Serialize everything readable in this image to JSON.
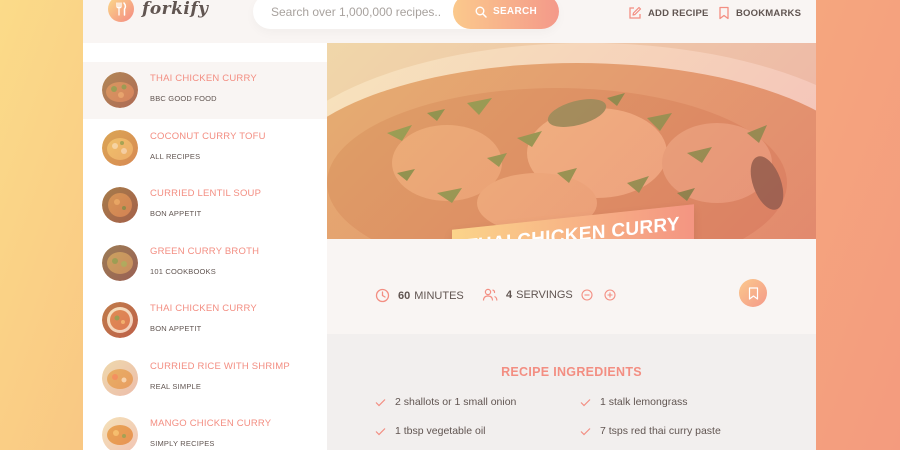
{
  "header": {
    "logo_text": "forkify",
    "search_placeholder": "Search over 1,000,000 recipes...",
    "search_button": "SEARCH",
    "add_recipe": "ADD RECIPE",
    "bookmarks": "BOOKMARKS"
  },
  "results": [
    {
      "title": "THAI CHICKEN CURRY",
      "publisher": "BBC GOOD FOOD",
      "active": true
    },
    {
      "title": "COCONUT CURRY TOFU",
      "publisher": "ALL RECIPES",
      "active": false
    },
    {
      "title": "CURRIED LENTIL SOUP",
      "publisher": "BON APPETIT",
      "active": false
    },
    {
      "title": "GREEN CURRY BROTH",
      "publisher": "101 COOKBOOKS",
      "active": false
    },
    {
      "title": "THAI CHICKEN CURRY",
      "publisher": "BON APPETIT",
      "active": false
    },
    {
      "title": "CURRIED RICE WITH SHRIMP",
      "publisher": "REAL SIMPLE",
      "active": false
    },
    {
      "title": "MANGO CHICKEN CURRY",
      "publisher": "SIMPLY RECIPES",
      "active": false
    }
  ],
  "recipe": {
    "title": "THAI CHICKEN CURRY",
    "minutes_value": "60",
    "minutes_unit": "MINUTES",
    "servings_value": "4",
    "servings_unit": "SERVINGS",
    "ingredients_heading": "RECIPE INGREDIENTS",
    "ingredients": [
      "2 shallots or 1 small onion",
      "1 stalk lemongrass",
      "1 tbsp vegetable oil",
      "7 tsps red thai curry paste"
    ]
  },
  "colors": {
    "accent": "#f38e82",
    "gradient_start": "#fbdb89",
    "gradient_end": "#f48982",
    "text": "#615551",
    "panel": "#f9f5f3"
  },
  "icons": {
    "search": "search-icon",
    "add_recipe": "edit-icon",
    "bookmarks": "bookmark-icon",
    "clock": "clock-icon",
    "users": "users-icon",
    "minus": "minus-circle-icon",
    "plus": "plus-circle-icon",
    "check": "check-icon"
  }
}
